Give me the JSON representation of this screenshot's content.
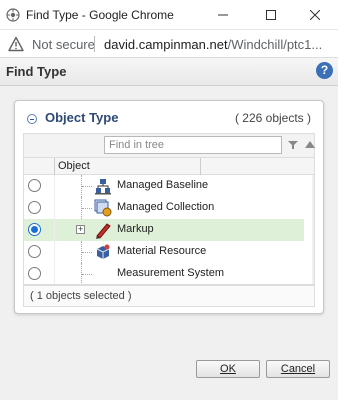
{
  "window": {
    "title": "Find Type - Google Chrome",
    "minimize_label": "minimize",
    "maximize_label": "maximize",
    "close_label": "close"
  },
  "address": {
    "security_label": "Not secure",
    "url_host": "david.campinman.net",
    "url_path": "/Windchill/ptc1..."
  },
  "dialog": {
    "title": "Find Type",
    "help_label": "?"
  },
  "panel": {
    "title": "Object Type",
    "count_label": "( 226 objects )",
    "find_placeholder": "Find in tree",
    "column_header": "Object",
    "selection_label": "( 1 objects selected )",
    "rows": [
      {
        "label": "Managed Baseline",
        "selected": false,
        "icon": "managed-baseline-icon"
      },
      {
        "label": "Managed Collection",
        "selected": false,
        "icon": "managed-collection-icon"
      },
      {
        "label": "Markup",
        "selected": true,
        "icon": "markup-pen-icon"
      },
      {
        "label": "Material Resource",
        "selected": false,
        "icon": "material-resource-icon"
      },
      {
        "label": "Measurement System",
        "selected": false,
        "icon": ""
      }
    ]
  },
  "buttons": {
    "ok_label": "OK",
    "cancel_label": "Cancel"
  },
  "colors": {
    "selected_row": "#dff0d8",
    "panel_title": "#2e4a77",
    "help_blue": "#3b6fb6"
  }
}
